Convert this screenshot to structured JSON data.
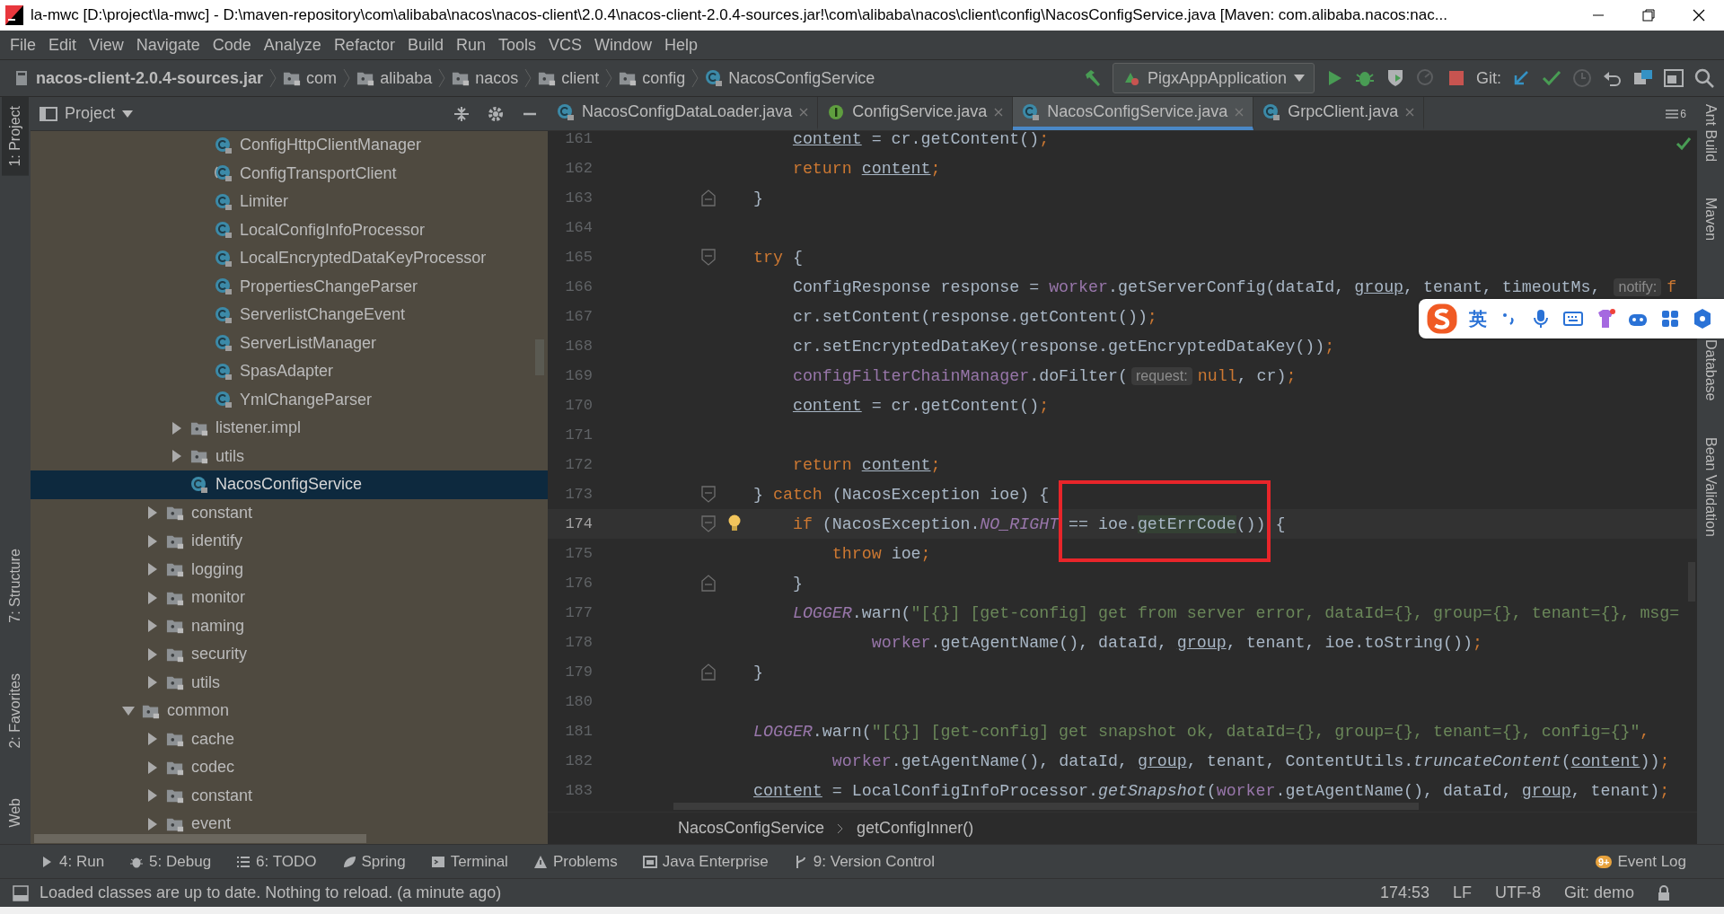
{
  "window": {
    "title": "la-mwc [D:\\project\\la-mwc] - D:\\maven-repository\\com\\alibaba\\nacos\\nacos-client\\2.0.4\\nacos-client-2.0.4-sources.jar!\\com\\alibaba\\nacos\\client\\config\\NacosConfigService.java [Maven: com.alibaba.nacos:nac..."
  },
  "menu": [
    "File",
    "Edit",
    "View",
    "Navigate",
    "Code",
    "Analyze",
    "Refactor",
    "Build",
    "Run",
    "Tools",
    "VCS",
    "Window",
    "Help"
  ],
  "breadcrumbs": [
    {
      "label": "nacos-client-2.0.4-sources.jar",
      "kind": "jar"
    },
    {
      "label": "com",
      "kind": "folder"
    },
    {
      "label": "alibaba",
      "kind": "folder"
    },
    {
      "label": "nacos",
      "kind": "folder"
    },
    {
      "label": "client",
      "kind": "folder"
    },
    {
      "label": "config",
      "kind": "folder"
    },
    {
      "label": "NacosConfigService",
      "kind": "class"
    }
  ],
  "run_config": "PigxAppApplication",
  "vcs_label": "Git:",
  "left_stripe": [
    {
      "label": "1: Project",
      "selected": true
    },
    {
      "label": "7: Structure",
      "selected": false
    },
    {
      "label": "2: Favorites",
      "selected": false
    },
    {
      "label": "Web",
      "selected": false
    }
  ],
  "project_panel": {
    "title": "Project",
    "tree": [
      {
        "children": [
          {
            "children": [
              {
                "children": [
                  {
                    "label": "ConfigHttpClientManager",
                    "kind": "class",
                    "selected": false
                  },
                  {
                    "label": "ConfigTransportClient",
                    "kind": "abstract",
                    "selected": false
                  },
                  {
                    "label": "Limiter",
                    "kind": "class",
                    "selected": false
                  },
                  {
                    "label": "LocalConfigInfoProcessor",
                    "kind": "class",
                    "selected": false
                  },
                  {
                    "label": "LocalEncryptedDataKeyProcessor",
                    "kind": "class",
                    "selected": false
                  },
                  {
                    "label": "PropertiesChangeParser",
                    "kind": "class",
                    "selected": false
                  },
                  {
                    "label": "ServerlistChangeEvent",
                    "kind": "class",
                    "selected": false
                  },
                  {
                    "label": "ServerListManager",
                    "kind": "class",
                    "selected": false
                  },
                  {
                    "label": "SpasAdapter",
                    "kind": "class",
                    "selected": false
                  },
                  {
                    "label": "YmlChangeParser",
                    "kind": "class",
                    "selected": false
                  }
                ]
              },
              {
                "label": "listener.impl",
                "kind": "folder",
                "expanded": false,
                "selected": false
              },
              {
                "label": "utils",
                "kind": "folder",
                "expanded": false,
                "selected": false
              },
              {
                "label": "NacosConfigService",
                "kind": "class",
                "selected": true
              }
            ]
          },
          {
            "label": "constant",
            "kind": "folder",
            "expanded": false,
            "selected": false
          },
          {
            "label": "identify",
            "kind": "folder",
            "expanded": false,
            "selected": false
          },
          {
            "label": "logging",
            "kind": "folder",
            "expanded": false,
            "selected": false
          },
          {
            "label": "monitor",
            "kind": "folder",
            "expanded": false,
            "selected": false
          },
          {
            "label": "naming",
            "kind": "folder",
            "expanded": false,
            "selected": false
          },
          {
            "label": "security",
            "kind": "folder",
            "expanded": false,
            "selected": false
          },
          {
            "label": "utils",
            "kind": "folder",
            "expanded": false,
            "selected": false
          }
        ]
      },
      {
        "label": "common",
        "kind": "folder",
        "expanded": true,
        "selected": false,
        "children": [
          {
            "label": "cache",
            "kind": "folder",
            "expanded": false,
            "selected": false
          },
          {
            "label": "codec",
            "kind": "folder",
            "expanded": false,
            "selected": false
          },
          {
            "label": "constant",
            "kind": "folder",
            "expanded": false,
            "selected": false
          },
          {
            "label": "event",
            "kind": "folder",
            "expanded": false,
            "selected": false
          }
        ]
      }
    ]
  },
  "editor_tabs": [
    {
      "label": "NacosConfigDataLoader.java",
      "kind": "class",
      "selected": false
    },
    {
      "label": "ConfigService.java",
      "kind": "interface",
      "selected": false
    },
    {
      "label": "NacosConfigService.java",
      "kind": "class",
      "selected": true
    },
    {
      "label": "GrpcClient.java",
      "kind": "class",
      "selected": false
    }
  ],
  "tab_count": "6",
  "code": {
    "lines": [
      {
        "number": "161",
        "kind": "indent1",
        "current": false,
        "fold_start": false,
        "fold_end": false,
        "bulb": false,
        "tokens": [
          {
            "t": "content",
            "kind": "underlined"
          },
          {
            "t": " = cr.getContent()",
            "kind": "plain"
          },
          {
            "t": ";",
            "kind": "keyword"
          }
        ]
      },
      {
        "number": "162",
        "kind": "indent1",
        "current": false,
        "fold_start": false,
        "fold_end": false,
        "bulb": false,
        "tokens": [
          {
            "t": "return ",
            "kind": "keyword"
          },
          {
            "t": "content",
            "kind": "underlined"
          },
          {
            "t": ";",
            "kind": "keyword"
          }
        ]
      },
      {
        "number": "163",
        "kind": "indent0",
        "current": false,
        "fold_start": false,
        "fold_end": true,
        "bulb": false,
        "tokens": [
          {
            "t": "}",
            "kind": "plain"
          }
        ]
      },
      {
        "number": "164",
        "current": false,
        "fold_start": false,
        "fold_end": false,
        "bulb": false
      },
      {
        "number": "165",
        "kind": "indent0",
        "current": false,
        "fold_start": true,
        "fold_end": false,
        "bulb": false,
        "tokens": [
          {
            "t": "try",
            "kind": "keyword"
          },
          {
            "t": " {",
            "kind": "plain"
          }
        ]
      },
      {
        "number": "166",
        "kind": "indent1",
        "current": false,
        "fold_start": false,
        "fold_end": false,
        "bulb": false,
        "tokens": [
          {
            "t": "ConfigResponse response = ",
            "kind": "plain"
          },
          {
            "t": "worker",
            "kind": "field"
          },
          {
            "t": ".getServerConfig(dataId, ",
            "kind": "plain"
          },
          {
            "t": "group",
            "kind": "underlined"
          },
          {
            "t": ", tenant, timeoutMs, ",
            "kind": "plain"
          },
          {
            "t": "notify:",
            "kind": "hint"
          },
          {
            "t": "f",
            "kind": "keyword"
          }
        ]
      },
      {
        "number": "167",
        "kind": "indent1",
        "current": false,
        "fold_start": false,
        "fold_end": false,
        "bulb": false,
        "tokens": [
          {
            "t": "cr.setContent(response.getContent())",
            "kind": "plain"
          },
          {
            "t": ";",
            "kind": "keyword"
          }
        ]
      },
      {
        "number": "168",
        "kind": "indent1",
        "current": false,
        "fold_start": false,
        "fold_end": false,
        "bulb": false,
        "tokens": [
          {
            "t": "cr.setEncryptedDataKey(response.getEncryptedDataKey())",
            "kind": "plain"
          },
          {
            "t": ";",
            "kind": "keyword"
          }
        ]
      },
      {
        "number": "169",
        "kind": "indent1",
        "current": false,
        "fold_start": false,
        "fold_end": false,
        "bulb": false,
        "tokens": [
          {
            "t": "configFilterChainManager",
            "kind": "field"
          },
          {
            "t": ".doFilter(",
            "kind": "plain"
          },
          {
            "t": "request:",
            "kind": "hint"
          },
          {
            "t": "null",
            "kind": "keyword"
          },
          {
            "t": ", cr)",
            "kind": "plain"
          },
          {
            "t": ";",
            "kind": "keyword"
          }
        ]
      },
      {
        "number": "170",
        "kind": "indent1",
        "current": false,
        "fold_start": false,
        "fold_end": false,
        "bulb": false,
        "tokens": [
          {
            "t": "content",
            "kind": "underlined"
          },
          {
            "t": " = cr.getContent()",
            "kind": "plain"
          },
          {
            "t": ";",
            "kind": "keyword"
          }
        ]
      },
      {
        "number": "171",
        "current": false,
        "fold_start": false,
        "fold_end": false,
        "bulb": false
      },
      {
        "number": "172",
        "kind": "indent1",
        "current": false,
        "fold_start": false,
        "fold_end": false,
        "bulb": false,
        "tokens": [
          {
            "t": "return ",
            "kind": "keyword"
          },
          {
            "t": "content",
            "kind": "underlined"
          },
          {
            "t": ";",
            "kind": "keyword"
          }
        ]
      },
      {
        "number": "173",
        "kind": "indent0",
        "current": false,
        "fold_start": true,
        "fold_end": false,
        "bulb": false,
        "tokens": [
          {
            "t": "} ",
            "kind": "plain"
          },
          {
            "t": "catch",
            "kind": "keyword"
          },
          {
            "t": " (NacosException ioe) {",
            "kind": "plain"
          }
        ]
      },
      {
        "number": "174",
        "kind": "indent1",
        "current": true,
        "fold_start": true,
        "fold_end": false,
        "bulb": true,
        "tokens": [
          {
            "t": "if",
            "kind": "keyword"
          },
          {
            "t": " (NacosException.",
            "kind": "plain"
          },
          {
            "t": "NO_RIGHT",
            "kind": "static"
          },
          {
            "t": " == ioe.",
            "kind": "plain"
          },
          {
            "t": "getErrCode",
            "kind": "highlight"
          },
          {
            "t": "()) {",
            "kind": "plain"
          }
        ]
      },
      {
        "number": "175",
        "kind": "indent2",
        "current": false,
        "fold_start": false,
        "fold_end": false,
        "bulb": false,
        "tokens": [
          {
            "t": "throw",
            "kind": "keyword"
          },
          {
            "t": " ioe",
            "kind": "plain"
          },
          {
            "t": ";",
            "kind": "keyword"
          }
        ]
      },
      {
        "number": "176",
        "kind": "indent1",
        "current": false,
        "fold_start": false,
        "fold_end": true,
        "bulb": false,
        "tokens": [
          {
            "t": "}",
            "kind": "plain"
          }
        ]
      },
      {
        "number": "177",
        "kind": "indent1",
        "current": false,
        "fold_start": false,
        "fold_end": false,
        "bulb": false,
        "tokens": [
          {
            "t": "LOGGER",
            "kind": "static"
          },
          {
            "t": ".warn(",
            "kind": "plain"
          },
          {
            "t": "\"[{}] [get-config] get from server error, dataId={}, group={}, tenant={}, msg=",
            "kind": "string"
          }
        ]
      },
      {
        "number": "178",
        "kind": "indent3",
        "current": false,
        "fold_start": false,
        "fold_end": false,
        "bulb": false,
        "tokens": [
          {
            "t": "worker",
            "kind": "field"
          },
          {
            "t": ".getAgentName(), dataId, ",
            "kind": "plain"
          },
          {
            "t": "group",
            "kind": "underlined"
          },
          {
            "t": ", tenant, ioe.toString())",
            "kind": "plain"
          },
          {
            "t": ";",
            "kind": "keyword"
          }
        ]
      },
      {
        "number": "179",
        "kind": "indent0",
        "current": false,
        "fold_start": false,
        "fold_end": true,
        "bulb": false,
        "tokens": [
          {
            "t": "}",
            "kind": "plain"
          }
        ]
      },
      {
        "number": "180",
        "current": false,
        "fold_start": false,
        "fold_end": false,
        "bulb": false
      },
      {
        "number": "181",
        "kind": "indent0",
        "current": false,
        "fold_start": false,
        "fold_end": false,
        "bulb": false,
        "tokens": [
          {
            "t": "LOGGER",
            "kind": "static"
          },
          {
            "t": ".warn(",
            "kind": "plain"
          },
          {
            "t": "\"[{}] [get-config] get snapshot ok, dataId={}, group={}, tenant={}, config={}\"",
            "kind": "string"
          },
          {
            "t": ",",
            "kind": "keyword"
          }
        ]
      },
      {
        "number": "182",
        "kind": "indent2",
        "current": false,
        "fold_start": false,
        "fold_end": false,
        "bulb": false,
        "tokens": [
          {
            "t": "worker",
            "kind": "field"
          },
          {
            "t": ".getAgentName(), dataId, ",
            "kind": "plain"
          },
          {
            "t": "group",
            "kind": "underlined"
          },
          {
            "t": ", tenant, ContentUtils.",
            "kind": "plain"
          },
          {
            "t": "truncateContent",
            "kind": "italic"
          },
          {
            "t": "(",
            "kind": "plain"
          },
          {
            "t": "content",
            "kind": "underlined"
          },
          {
            "t": "))",
            "kind": "plain"
          },
          {
            "t": ";",
            "kind": "keyword"
          }
        ]
      },
      {
        "number": "183",
        "kind": "indent0",
        "current": false,
        "fold_start": false,
        "fold_end": false,
        "bulb": false,
        "tokens": [
          {
            "t": "content",
            "kind": "underlined"
          },
          {
            "t": " = LocalConfigInfoProcessor.",
            "kind": "plain"
          },
          {
            "t": "getSnapshot",
            "kind": "italic"
          },
          {
            "t": "(",
            "kind": "plain"
          },
          {
            "t": "worker",
            "kind": "field"
          },
          {
            "t": ".getAgentName(), dataId, ",
            "kind": "plain"
          },
          {
            "t": "group",
            "kind": "underlined"
          },
          {
            "t": ", tenant)",
            "kind": "plain"
          },
          {
            "t": ";",
            "kind": "keyword"
          }
        ]
      }
    ]
  },
  "editor_breadcrumbs": [
    "NacosConfigService",
    "getConfigInner()"
  ],
  "right_stripe": [
    "Ant Build",
    "Maven",
    "Database",
    "Bean Validation"
  ],
  "ime": {
    "label": "英"
  },
  "tool_windows": [
    {
      "label": "4: Run",
      "kind": "run"
    },
    {
      "label": "5: Debug",
      "kind": "debug"
    },
    {
      "label": "6: TODO",
      "kind": "todo"
    },
    {
      "label": "Spring",
      "kind": "spring"
    },
    {
      "label": "Terminal",
      "kind": "terminal"
    },
    {
      "label": "Problems",
      "kind": "problems"
    },
    {
      "label": "Java Enterprise",
      "kind": "enterprise"
    },
    {
      "label": "9: Version Control",
      "kind": "vcs"
    }
  ],
  "event_log": {
    "label": "Event Log",
    "badge": "9+"
  },
  "status_bar": {
    "message": "Loaded classes are up to date. Nothing to reload. (a minute ago)",
    "position": "174:53",
    "line_separator": "LF",
    "encoding": "UTF-8",
    "branch": "Git: demo"
  }
}
